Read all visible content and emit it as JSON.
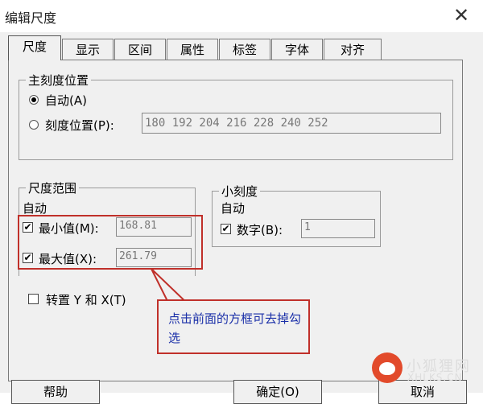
{
  "window": {
    "title": "编辑尺度",
    "close_glyph": "✕"
  },
  "tabs": [
    {
      "label": "尺度"
    },
    {
      "label": "显示"
    },
    {
      "label": "区间"
    },
    {
      "label": "属性"
    },
    {
      "label": "标签"
    },
    {
      "label": "字体"
    },
    {
      "label": "对齐"
    }
  ],
  "active_tab": "尺度",
  "major_tick": {
    "title": "主刻度位置",
    "auto_label": "自动(A)",
    "position_label": "刻度位置(P):",
    "selected": "auto",
    "positions_value": "180 192 204 216 228 240 252"
  },
  "scale_range": {
    "title": "尺度范围",
    "auto_text": "自动",
    "min_label": "最小值(M):",
    "min_checked": true,
    "min_value": "168.81",
    "max_label": "最大值(X):",
    "max_checked": true,
    "max_value": "261.79"
  },
  "minor_tick": {
    "title": "小刻度",
    "auto_text": "自动",
    "number_label": "数字(B):",
    "number_checked": true,
    "number_value": "1"
  },
  "transpose": {
    "label": "转置 Y 和 X(T)",
    "checked": false
  },
  "annotation": {
    "text": "点击前面的方框可去掉勾选",
    "border_color": "#c0302a",
    "text_color": "#1a2fa8"
  },
  "buttons": {
    "help": "帮助",
    "ok": "确定(O)",
    "cancel": "取消"
  },
  "watermark": {
    "cn": "小狐狸网",
    "en": "XHLKS.CN"
  }
}
